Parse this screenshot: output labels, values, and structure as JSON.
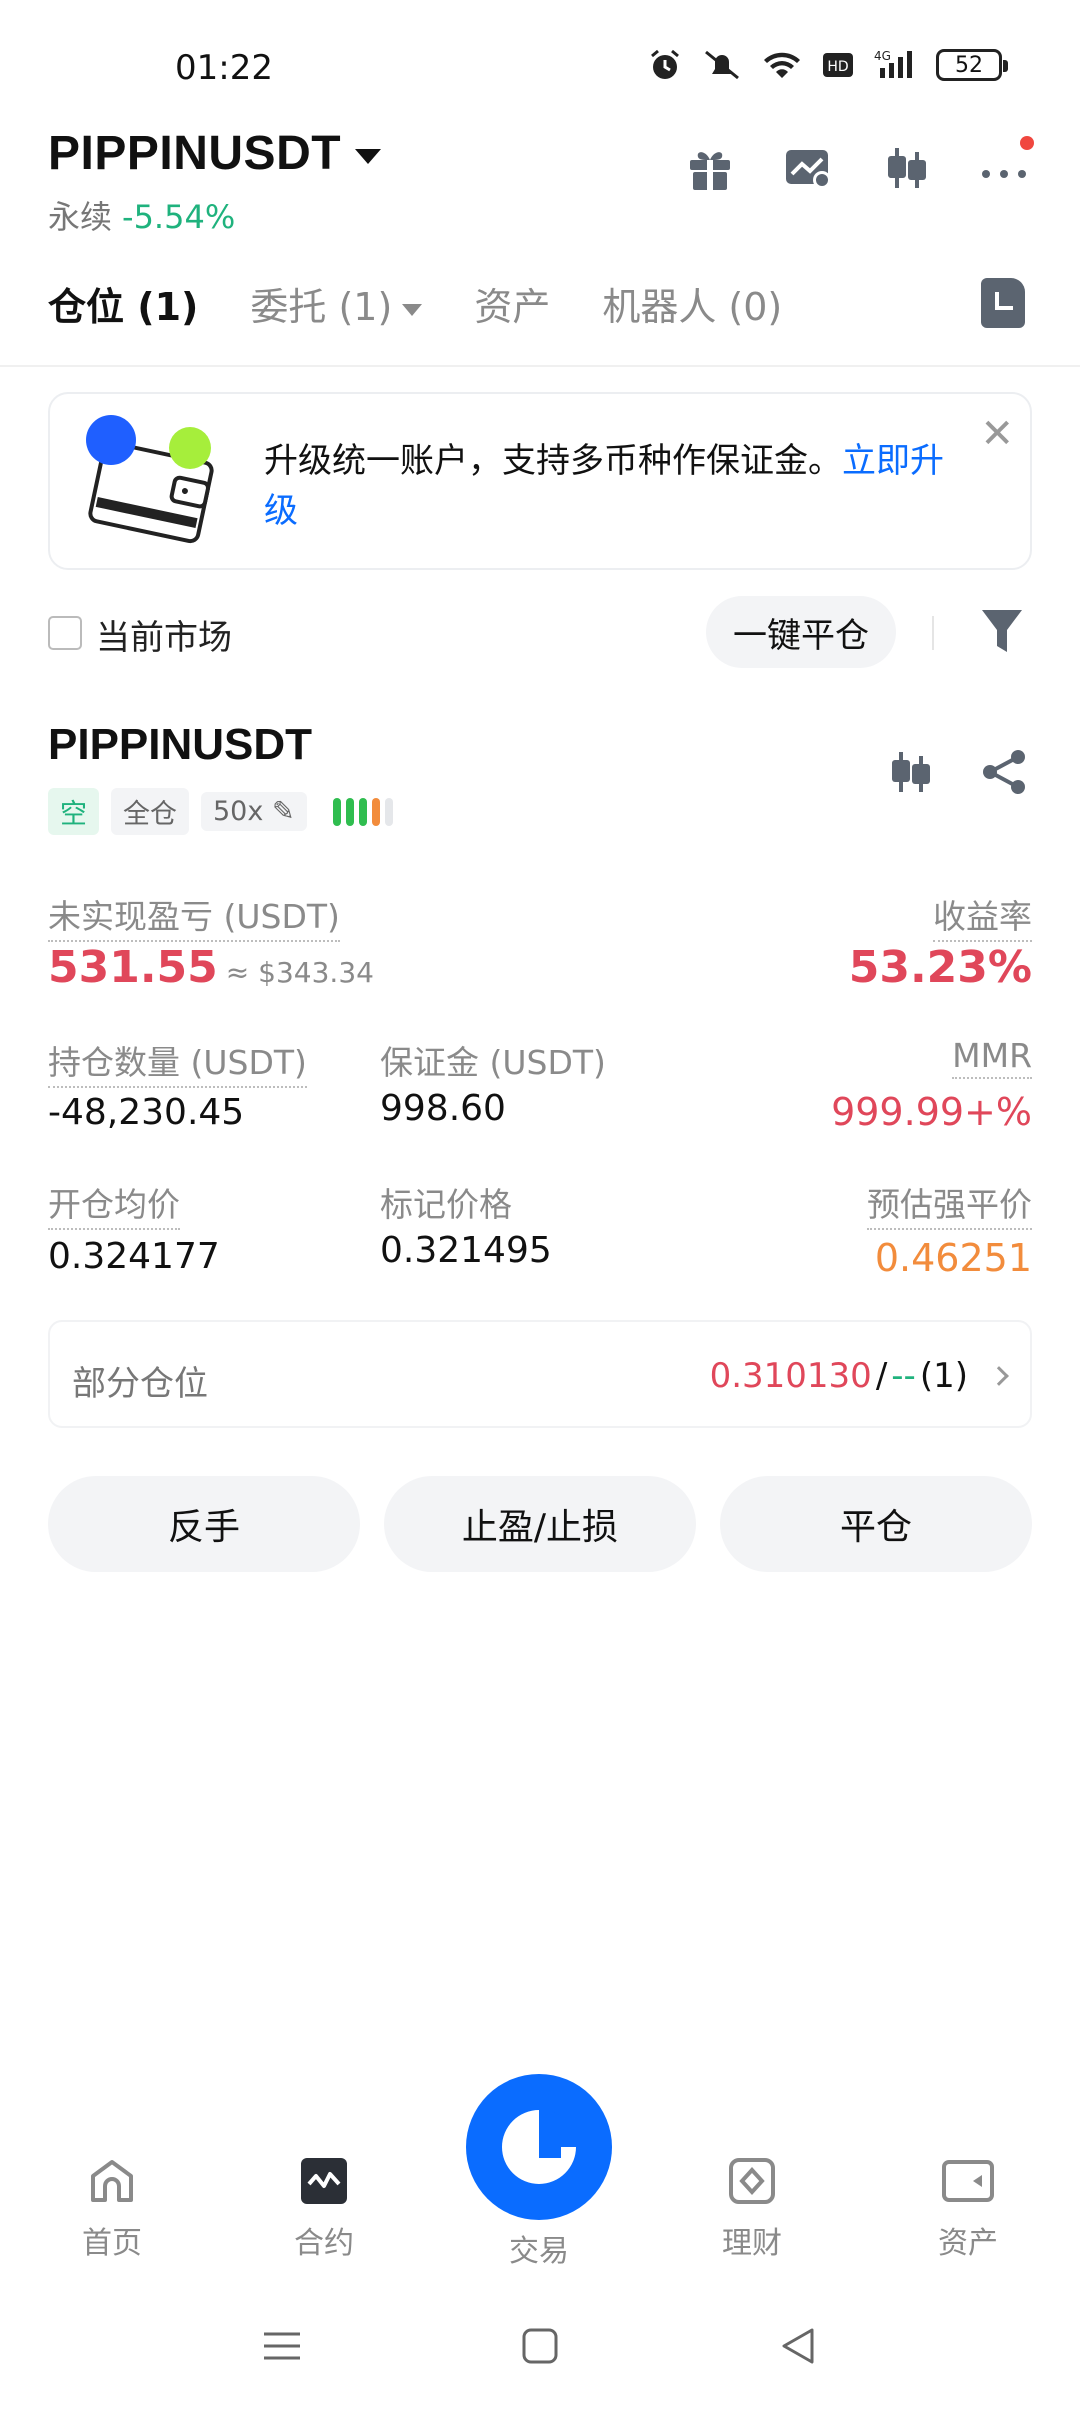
{
  "status_bar": {
    "time": "01:22",
    "battery": "52"
  },
  "header": {
    "symbol": "PIPPINUSDT",
    "contract_type": "永续",
    "change": "-5.54%"
  },
  "tabs": [
    {
      "label": "仓位 (1)"
    },
    {
      "label": "委托 (1)"
    },
    {
      "label": "资产"
    },
    {
      "label": "机器人 (0)"
    }
  ],
  "banner": {
    "text": "升级统一账户，支持多币种作保证金。",
    "link": "立即升级"
  },
  "filter": {
    "current_market": "当前市场",
    "close_all": "一键平仓"
  },
  "position": {
    "symbol": "PIPPINUSDT",
    "side_tag": "空",
    "margin_mode_tag": "全仓",
    "leverage_tag": "50x",
    "unrealized_pnl_label": "未实现盈亏 (USDT)",
    "unrealized_pnl": "531.55",
    "unrealized_pnl_usd": "≈ $343.34",
    "roe_label": "收益率",
    "roe": "53.23%",
    "size_label": "持仓数量 (USDT)",
    "size": "-48,230.45",
    "margin_label": "保证金 (USDT)",
    "margin": "998.60",
    "mmr_label": "MMR",
    "mmr": "999.99+%",
    "entry_label": "开仓均价",
    "entry": "0.324177",
    "mark_label": "标记价格",
    "mark": "0.321495",
    "liq_label": "预估强平价",
    "liq": "0.46251",
    "partial_label": "部分仓位",
    "partial_price": "0.310130",
    "partial_sep": "/",
    "partial_dash": "--",
    "partial_count": "(1)"
  },
  "actions": {
    "reverse": "反手",
    "tpsl": "止盈/止损",
    "close": "平仓"
  },
  "bottom_nav": {
    "home": "首页",
    "futures": "合约",
    "trade": "交易",
    "earn": "理财",
    "assets": "资产"
  },
  "colors": {
    "accent": "#0a6cff",
    "down_red": "#e0475a",
    "up_green": "#1fb27d",
    "warning_orange": "#f28c3c"
  }
}
